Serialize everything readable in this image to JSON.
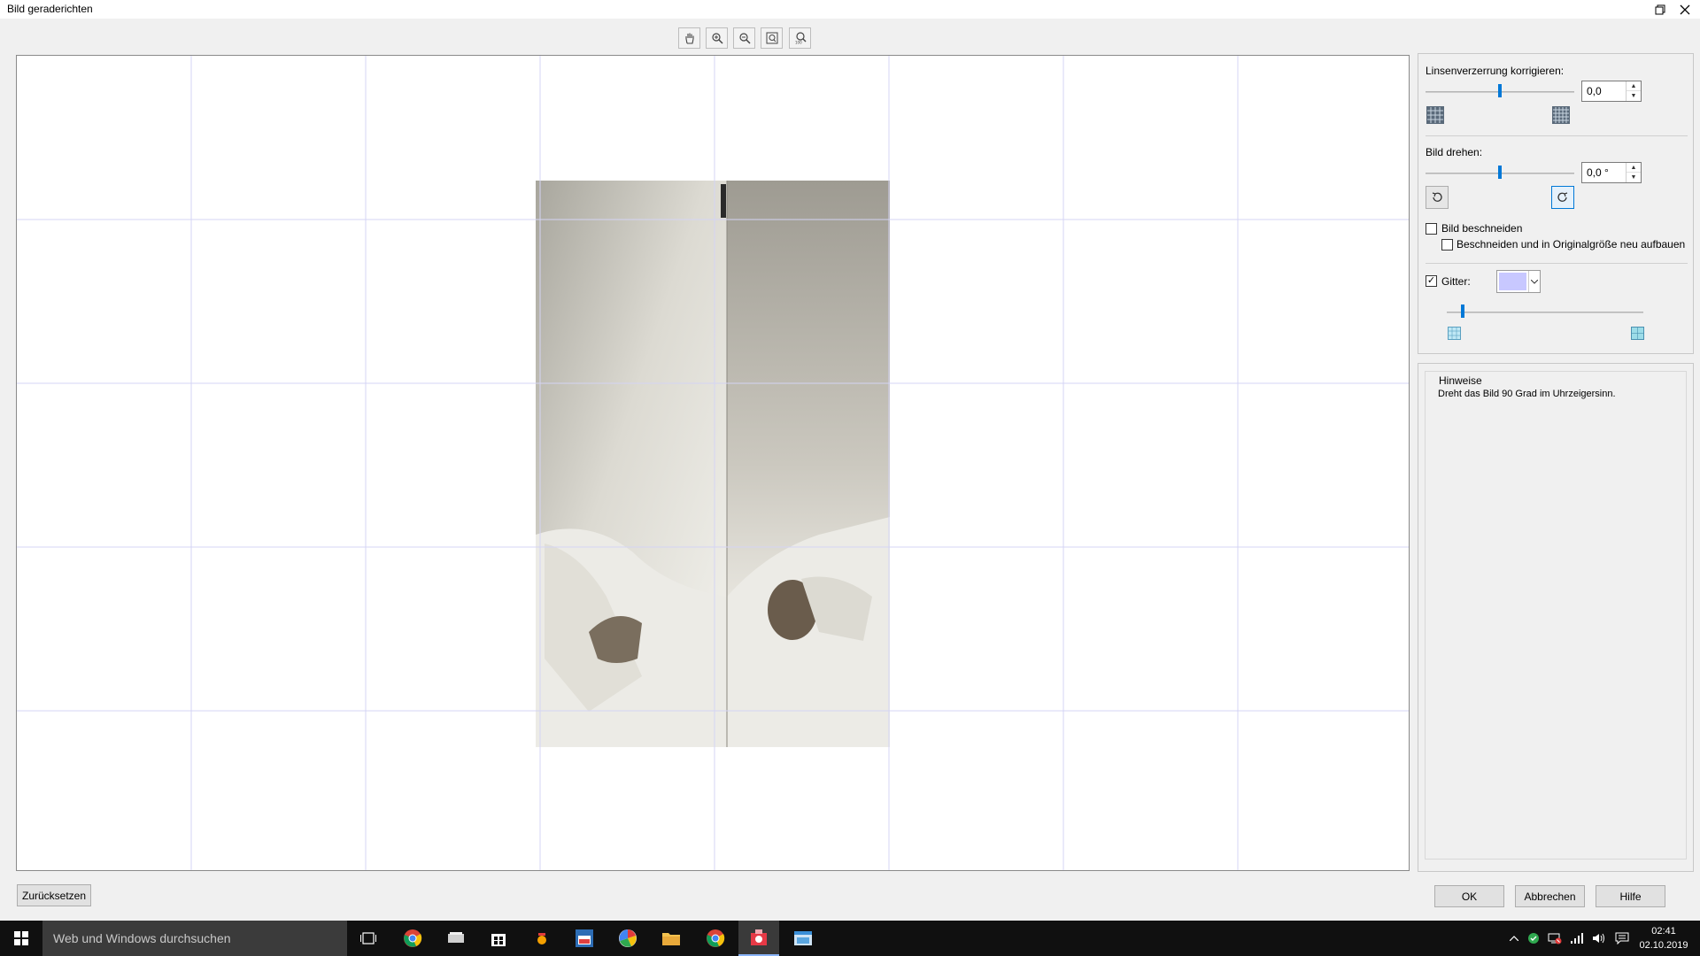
{
  "window": {
    "title": "Bild geraderichten"
  },
  "toolbar": {
    "tools": [
      "pan",
      "zoom-in",
      "zoom-out",
      "fit",
      "zoom-100"
    ]
  },
  "panel": {
    "lens": {
      "label": "Linsenverzerrung korrigieren:",
      "value": "0,0",
      "slider_fraction": 0.5
    },
    "rotate": {
      "label": "Bild drehen:",
      "value": "0,0 °",
      "slider_fraction": 0.5
    },
    "crop": {
      "label": "Bild beschneiden",
      "checked": false,
      "sub_label": "Beschneiden und in Originalgröße neu aufbauen",
      "sub_checked": false
    },
    "grid": {
      "label": "Gitter:",
      "checked": true,
      "color": "#c8c8ff",
      "size_fraction": 0.08
    }
  },
  "hints": {
    "title": "Hinweise",
    "text": "Dreht das Bild 90 Grad im Uhrzeigersinn."
  },
  "buttons": {
    "reset": "Zurücksetzen",
    "ok": "OK",
    "cancel": "Abbrechen",
    "help": "Hilfe"
  },
  "taskbar": {
    "search_placeholder": "Web und Windows durchsuchen",
    "time": "02:41",
    "date": "02.10.2019"
  }
}
